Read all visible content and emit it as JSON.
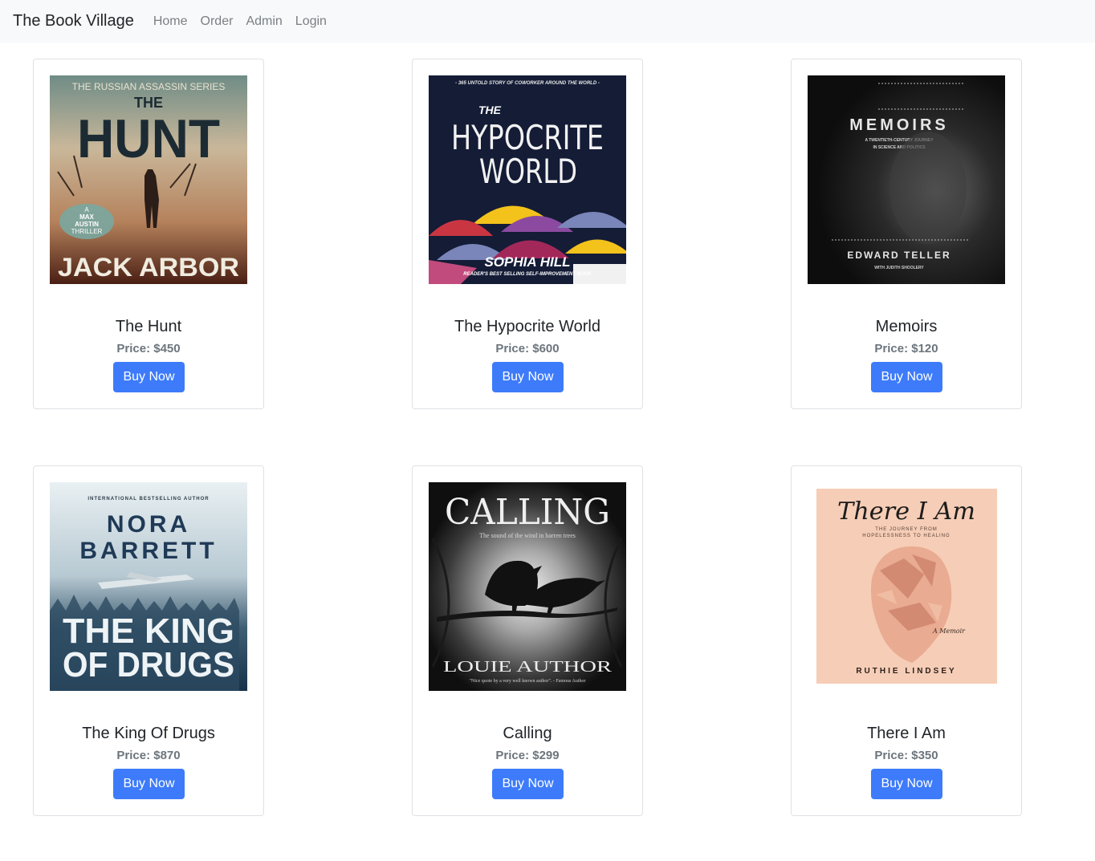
{
  "nav": {
    "brand": "The Book Village",
    "links": [
      "Home",
      "Order",
      "Admin",
      "Login"
    ]
  },
  "price_prefix": "Price: ",
  "buy_label": "Buy Now",
  "colors": {
    "navbar_bg": "#f8f9fa",
    "button": "#3d7bfa",
    "price": "#6c757d"
  },
  "books": [
    {
      "title": "The Hunt",
      "price": "$450",
      "cover": {
        "series": "THE RUSSIAN ASSASSIN SERIES",
        "the": "THE",
        "main": "HUNT",
        "badge": [
          "A",
          "MAX",
          "AUSTIN",
          "THRILLER"
        ],
        "author": "JACK ARBOR"
      }
    },
    {
      "title": "The Hypocrite World",
      "price": "$600",
      "cover": {
        "tagline": "- 365 UNTOLD STORY OF COWORKER AROUND THE WORLD -",
        "the": "THE",
        "main1": "HYPOCRITE",
        "main2": "WORLD",
        "author": "SOPHIA HILL",
        "sub": "READER'S BEST SELLING SELF-IMPROVEMENT BOOK"
      }
    },
    {
      "title": "Memoirs",
      "price": "$120",
      "cover": {
        "main": "MEMOIRS",
        "sub1": "A TWENTIETH-CENTURY JOURNEY",
        "sub2": "IN SCIENCE AND POLITICS",
        "author": "EDWARD TELLER",
        "coauthor": "WITH JUDITH SHOOLERY"
      }
    },
    {
      "title": "The King Of Drugs",
      "price": "$870",
      "cover": {
        "top": "INTERNATIONAL BESTSELLING AUTHOR",
        "author1": "NORA",
        "author2": "BARRETT",
        "main1": "THE KING",
        "main2": "OF DRUGS"
      }
    },
    {
      "title": "Calling",
      "price": "$299",
      "cover": {
        "main": "CALLING",
        "tagline": "The sound of the wind in barren trees",
        "author": "LOUIE AUTHOR",
        "quote": "\"Nice quote by a very well known author\". - Famous Author"
      }
    },
    {
      "title": "There I Am",
      "price": "$350",
      "cover": {
        "main": "There I Am",
        "sub1": "THE JOURNEY FROM",
        "sub2": "HOPELESSNESS TO HEALING",
        "memoir": "A Memoir",
        "author": "RUTHIE LINDSEY"
      }
    }
  ]
}
